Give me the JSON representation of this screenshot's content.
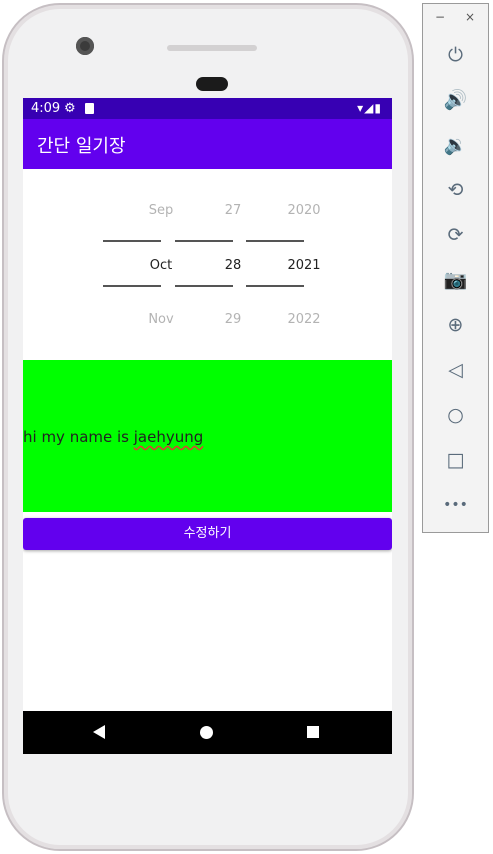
{
  "device_screen": {
    "status_bar": {
      "time": "4:09",
      "settings_icon": "gear-icon",
      "storage_icon": "sd-card-icon",
      "right_icons": "▾◢▮"
    },
    "app_bar": {
      "title": "간단 일기장"
    },
    "date_picker": {
      "month": {
        "prev": "Sep",
        "selected": "Oct",
        "next": "Nov"
      },
      "day": {
        "prev": "27",
        "selected": "28",
        "next": "29"
      },
      "year": {
        "prev": "2020",
        "selected": "2021",
        "next": "2022"
      }
    },
    "diary_text": {
      "prefix": "hi my name is ",
      "misspelled": "jaehyung"
    },
    "edit_button": {
      "label": "수정하기"
    },
    "nav_bar": {
      "back": "back-icon",
      "home": "home-icon",
      "recents": "recents-icon"
    },
    "colors": {
      "status": "#3700b3",
      "primary": "#6200ee",
      "diary_bg": "#00ff00"
    }
  },
  "emulator_toolbar": {
    "minimize": "−",
    "close": "×",
    "buttons": [
      {
        "name": "power",
        "glyph": "⏻"
      },
      {
        "name": "volume-up",
        "glyph": "🔊"
      },
      {
        "name": "volume-down",
        "glyph": "🔉"
      },
      {
        "name": "rotate-left",
        "glyph": "⟲"
      },
      {
        "name": "rotate-right",
        "glyph": "⟳"
      },
      {
        "name": "screenshot",
        "glyph": "📷"
      },
      {
        "name": "zoom",
        "glyph": "⊕"
      },
      {
        "name": "back",
        "glyph": "◁"
      },
      {
        "name": "home",
        "glyph": "○"
      },
      {
        "name": "overview",
        "glyph": "□"
      },
      {
        "name": "more",
        "glyph": "•••"
      }
    ]
  }
}
